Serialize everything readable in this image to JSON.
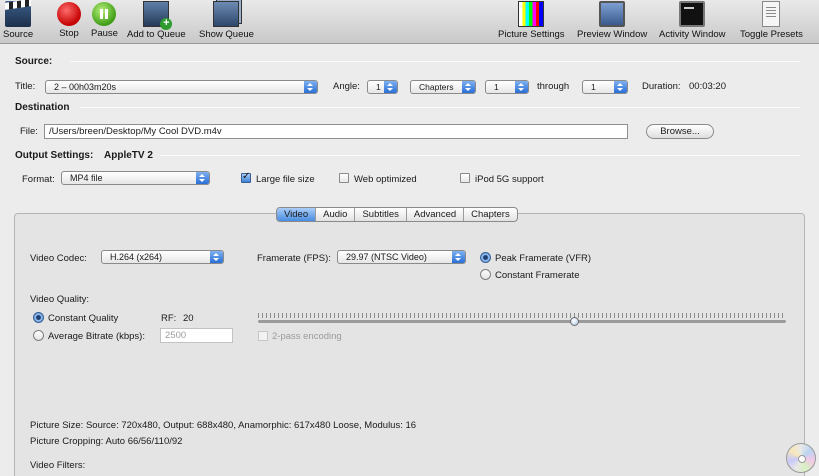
{
  "toolbar": {
    "source": "Source",
    "stop": "Stop",
    "pause": "Pause",
    "add_to_queue": "Add to Queue",
    "show_queue": "Show Queue",
    "picture_settings": "Picture Settings",
    "preview_window": "Preview Window",
    "activity_window": "Activity Window",
    "toggle_presets": "Toggle Presets",
    "icons": [
      "clapperboard-icon",
      "stop-icon",
      "pause-icon",
      "add-queue-icon",
      "show-queue-icon",
      "picture-settings-icon",
      "preview-window-icon",
      "activity-window-icon",
      "toggle-presets-icon"
    ]
  },
  "source": {
    "heading": "Source:",
    "title_label": "Title:",
    "title_value": "2 – 00h03m20s",
    "angle_label": "Angle:",
    "angle_value": "1",
    "range_type": "Chapters",
    "range_from": "1",
    "through_label": "through",
    "range_to": "1",
    "duration_label": "Duration:",
    "duration_value": "00:03:20"
  },
  "destination": {
    "heading": "Destination",
    "file_label": "File:",
    "file_value": "/Users/breen/Desktop/My Cool DVD.m4v",
    "browse_label": "Browse..."
  },
  "output": {
    "heading": "Output Settings:",
    "preset": "AppleTV 2",
    "format_label": "Format:",
    "format_value": "MP4 file",
    "large_file_label": "Large file size",
    "large_file_checked": true,
    "web_optimized_label": "Web optimized",
    "web_optimized_checked": false,
    "ipod_label": "iPod 5G support",
    "ipod_checked": false
  },
  "tabs": [
    {
      "label": "Video",
      "active": true
    },
    {
      "label": "Audio",
      "active": false
    },
    {
      "label": "Subtitles",
      "active": false
    },
    {
      "label": "Advanced",
      "active": false
    },
    {
      "label": "Chapters",
      "active": false
    }
  ],
  "video": {
    "codec_label": "Video Codec:",
    "codec_value": "H.264 (x264)",
    "framerate_label": "Framerate (FPS):",
    "framerate_value": "29.97 (NTSC Video)",
    "peak_framerate_label": "Peak Framerate (VFR)",
    "constant_framerate_label": "Constant Framerate",
    "quality_label": "Video Quality:",
    "constant_quality_label": "Constant Quality",
    "rf_label": "RF:",
    "rf_value": "20",
    "avg_bitrate_label": "Average Bitrate (kbps):",
    "avg_bitrate_value": "2500",
    "two_pass_label": "2-pass encoding",
    "quality_slider_fraction": 0.6
  },
  "info": {
    "picture_size": "Picture Size: Source: 720x480, Output: 688x480, Anamorphic: 617x480 Loose, Modulus: 16",
    "picture_cropping": "Picture Cropping: Auto 66/56/110/92",
    "video_filters": "Video Filters:"
  }
}
